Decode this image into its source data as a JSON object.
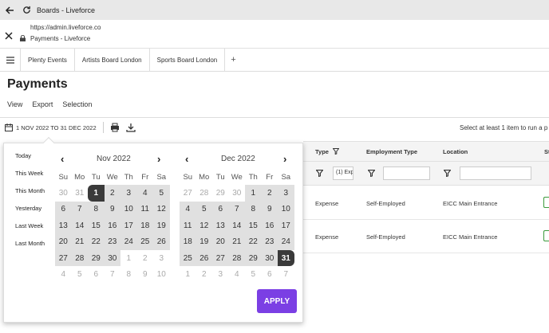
{
  "browser": {
    "tab_title": "Boards - Liveforce",
    "url": "https://admin.liveforce.co",
    "page_title": "Payments - Liveforce"
  },
  "tabs": [
    {
      "label": "Plenty Events"
    },
    {
      "label": "Artists Board London"
    },
    {
      "label": "Sports Board London"
    }
  ],
  "add_tab_label": "+",
  "header": {
    "title": "Payments",
    "links": [
      "View",
      "Export",
      "Selection"
    ]
  },
  "daterange": {
    "label": "1 NOV 2022 TO 31 DEC 2022"
  },
  "select_message": "Select at least 1 item to run a p",
  "table": {
    "headers": [
      "Type",
      "Employment Type",
      "Location",
      "St"
    ],
    "filter_type_value": "(1) Exp",
    "rows": [
      {
        "type": "Expense",
        "employment": "Self-Employed",
        "location": "EICC Main Entrance"
      },
      {
        "type": "Expense",
        "employment": "Self-Employed",
        "location": "EICC Main Entrance"
      }
    ]
  },
  "picker": {
    "presets": [
      "Today",
      "This Week",
      "This Month",
      "Yesterday",
      "Last Week",
      "Last Month"
    ],
    "weekdays": [
      "Su",
      "Mo",
      "Tu",
      "We",
      "Th",
      "Fr",
      "Sa"
    ],
    "left": {
      "month": "Nov 2022",
      "days": [
        [
          "30",
          "out"
        ],
        [
          "31",
          "out"
        ],
        [
          "1",
          "sel"
        ],
        [
          "2",
          "in"
        ],
        [
          "3",
          "in"
        ],
        [
          "4",
          "in"
        ],
        [
          "5",
          "in"
        ],
        [
          "6",
          "in"
        ],
        [
          "7",
          "in"
        ],
        [
          "8",
          "in"
        ],
        [
          "9",
          "in"
        ],
        [
          "10",
          "in"
        ],
        [
          "11",
          "in"
        ],
        [
          "12",
          "in"
        ],
        [
          "13",
          "in"
        ],
        [
          "14",
          "in"
        ],
        [
          "15",
          "in"
        ],
        [
          "16",
          "in"
        ],
        [
          "17",
          "in"
        ],
        [
          "18",
          "in"
        ],
        [
          "19",
          "in"
        ],
        [
          "20",
          "in"
        ],
        [
          "21",
          "in"
        ],
        [
          "22",
          "in"
        ],
        [
          "23",
          "in"
        ],
        [
          "24",
          "in"
        ],
        [
          "25",
          "in"
        ],
        [
          "26",
          "in"
        ],
        [
          "27",
          "in"
        ],
        [
          "28",
          "in"
        ],
        [
          "29",
          "in"
        ],
        [
          "30",
          "in"
        ],
        [
          "1",
          "out"
        ],
        [
          "2",
          "out"
        ],
        [
          "3",
          "out"
        ],
        [
          "4",
          "out"
        ],
        [
          "5",
          "out"
        ],
        [
          "6",
          "out"
        ],
        [
          "7",
          "out"
        ],
        [
          "8",
          "out"
        ],
        [
          "9",
          "out"
        ],
        [
          "10",
          "out"
        ]
      ]
    },
    "right": {
      "month": "Dec 2022",
      "days": [
        [
          "27",
          "out"
        ],
        [
          "28",
          "out"
        ],
        [
          "29",
          "out"
        ],
        [
          "30",
          "out"
        ],
        [
          "1",
          "in"
        ],
        [
          "2",
          "in"
        ],
        [
          "3",
          "in"
        ],
        [
          "4",
          "in"
        ],
        [
          "5",
          "in"
        ],
        [
          "6",
          "in"
        ],
        [
          "7",
          "in"
        ],
        [
          "8",
          "in"
        ],
        [
          "9",
          "in"
        ],
        [
          "10",
          "in"
        ],
        [
          "11",
          "in"
        ],
        [
          "12",
          "in"
        ],
        [
          "13",
          "in"
        ],
        [
          "14",
          "in"
        ],
        [
          "15",
          "in"
        ],
        [
          "16",
          "in"
        ],
        [
          "17",
          "in"
        ],
        [
          "18",
          "in"
        ],
        [
          "19",
          "in"
        ],
        [
          "20",
          "in"
        ],
        [
          "21",
          "in"
        ],
        [
          "22",
          "in"
        ],
        [
          "23",
          "in"
        ],
        [
          "24",
          "in"
        ],
        [
          "25",
          "in"
        ],
        [
          "26",
          "in"
        ],
        [
          "27",
          "in"
        ],
        [
          "28",
          "in"
        ],
        [
          "29",
          "in"
        ],
        [
          "30",
          "in"
        ],
        [
          "31",
          "sel2"
        ],
        [
          "1",
          "out"
        ],
        [
          "2",
          "out"
        ],
        [
          "3",
          "out"
        ],
        [
          "4",
          "out"
        ],
        [
          "5",
          "out"
        ],
        [
          "6",
          "out"
        ],
        [
          "7",
          "out"
        ]
      ]
    },
    "apply_label": "APPLY"
  },
  "colors": {
    "accent": "#7b3fe4",
    "selected_day": "#3a3a3a",
    "range_bg": "#e0e0e0",
    "status_green": "#3c9a3c"
  }
}
